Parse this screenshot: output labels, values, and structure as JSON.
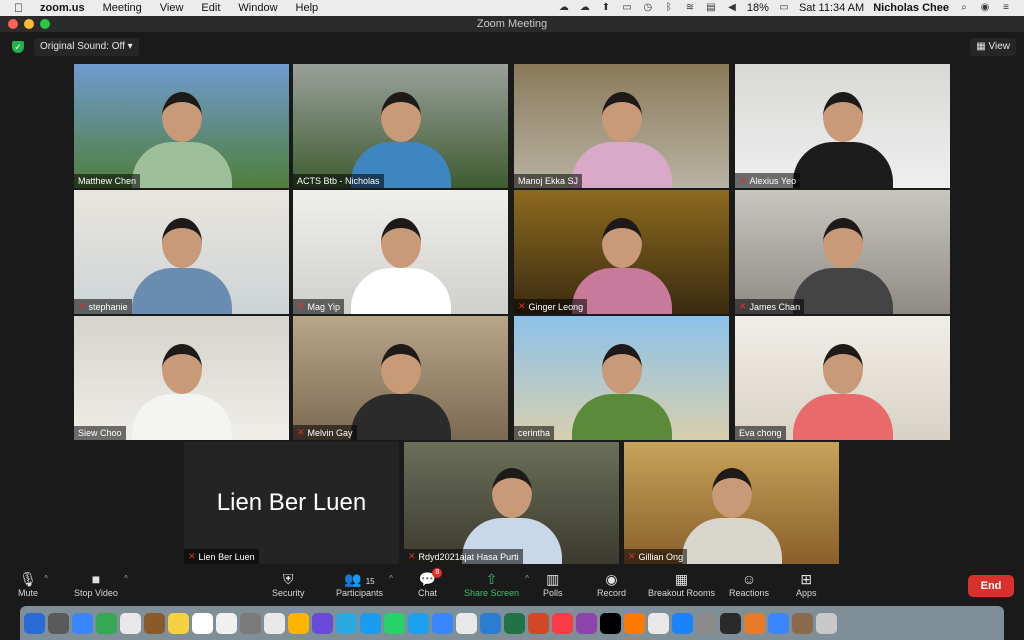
{
  "menubar": {
    "app": "zoom.us",
    "items": [
      "Meeting",
      "View",
      "Edit",
      "Window",
      "Help"
    ],
    "battery": "18%",
    "clock": "Sat 11:34 AM",
    "user": "Nicholas Chee"
  },
  "window": {
    "title": "Zoom Meeting"
  },
  "topbar": {
    "original_sound": "Original Sound: Off",
    "view_label": "View"
  },
  "participants": [
    {
      "name": "Matthew Chen",
      "muted": false,
      "bg": "#6f9bd0",
      "bg2": "#4f7e3a",
      "shirt": "#9dbf9a"
    },
    {
      "name": "ACTS Btb - Nicholas",
      "muted": false,
      "bg": "#9aa09a",
      "bg2": "#3f5c30",
      "shirt": "#3d86c2"
    },
    {
      "name": "Manoj Ekka SJ",
      "muted": false,
      "bg": "#8a7a5a",
      "bg2": "#b9b3a2",
      "shirt": "#d9a9c9"
    },
    {
      "name": "Alexius Yeo",
      "muted": true,
      "bg": "#d8d8d6",
      "bg2": "#efefef",
      "shirt": "#1c1c1c"
    },
    {
      "name": "stephanie",
      "muted": true,
      "bg": "#e9e5de",
      "bg2": "#cdd4d6",
      "shirt": "#6a8cb0"
    },
    {
      "name": "Mag Yip",
      "muted": true,
      "bg": "#efefec",
      "bg2": "#d0cfcc",
      "shirt": "#ffffff"
    },
    {
      "name": "Ginger Leong",
      "muted": true,
      "bg": "#8c6a1f",
      "bg2": "#3a2b10",
      "shirt": "#c87a9a"
    },
    {
      "name": "James Chan",
      "muted": true,
      "bg": "#c9c6bf",
      "bg2": "#8f8b84",
      "shirt": "#444444"
    },
    {
      "name": "Siew Choo",
      "muted": false,
      "bg": "#d6d3cb",
      "bg2": "#f0eee9",
      "shirt": "#f4f4f2"
    },
    {
      "name": "Melvin Gay",
      "muted": true,
      "bg": "#b8a58a",
      "bg2": "#7b6a52",
      "shirt": "#2b2b2b"
    },
    {
      "name": "cerintha",
      "muted": false,
      "bg": "#8cc2ea",
      "bg2": "#d8cfae",
      "shirt": "#5a8a3a"
    },
    {
      "name": "Eva chong",
      "muted": false,
      "bg": "#f1eee8",
      "bg2": "#d8d2c5",
      "shirt": "#e86a6a"
    },
    {
      "name": "Lien Ber Luen",
      "muted": true,
      "video_off": true
    },
    {
      "name": "Rdyd2021ajat Hasa Purti",
      "muted": true,
      "bg": "#6a6f5a",
      "bg2": "#3c3a2e",
      "shirt": "#c9d8e8"
    },
    {
      "name": "Gillian Ong",
      "muted": true,
      "bg": "#c7a35a",
      "bg2": "#8a5f2a",
      "shirt": "#d9d6ce"
    }
  ],
  "toolbar": {
    "mute": "Mute",
    "stop_video": "Stop Video",
    "security": "Security",
    "participants": "Participants",
    "participants_count": "15",
    "chat": "Chat",
    "chat_badge": "8",
    "share_screen": "Share Screen",
    "polls": "Polls",
    "record": "Record",
    "breakout_rooms": "Breakout Rooms",
    "reactions": "Reactions",
    "apps": "Apps",
    "end": "End"
  },
  "dock": {
    "app_colors": [
      "#2a6bd8",
      "#5a5a5a",
      "#3a86ff",
      "#34a853",
      "#e8e8e8",
      "#8a5a2a",
      "#f5d142",
      "#ffffff",
      "#f0f0f0",
      "#7a7a7a",
      "#e8e8e8",
      "#ffb400",
      "#6a4ad8",
      "#2aa9e0",
      "#1a9df0",
      "#25d366",
      "#1ea0f0",
      "#3a86ff",
      "#e8e8e8",
      "#2b7cd3",
      "#217346",
      "#d24726",
      "#fc3c44",
      "#8e44ad",
      "#000000",
      "#ff7a00",
      "#e8e8e8",
      "#1a82fb",
      "#8a8a8a",
      "#2a2a2a",
      "#e87a2a",
      "#3a86ff",
      "#8a6a4a",
      "#c8c8c8"
    ]
  }
}
